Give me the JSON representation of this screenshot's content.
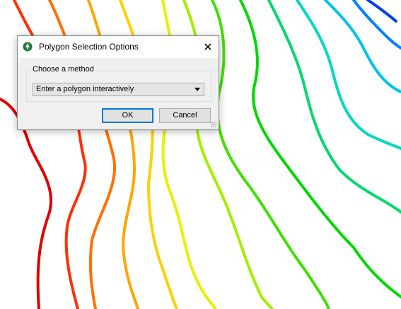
{
  "dialog": {
    "title": "Polygon Selection Options",
    "close_glyph": "✕",
    "group_label": "Choose a method",
    "selected_option": "Enter a polygon interactively",
    "ok_label": "OK",
    "cancel_label": "Cancel",
    "icon": "app-logo-icon"
  },
  "map": {
    "contour_colors": [
      "#e00000",
      "#ff3000",
      "#ff7000",
      "#ffa500",
      "#ffd000",
      "#e8f000",
      "#a0f000",
      "#40e000",
      "#00d800",
      "#00d870",
      "#00d8c0",
      "#00c0f0",
      "#0080ff",
      "#0040e0"
    ]
  }
}
